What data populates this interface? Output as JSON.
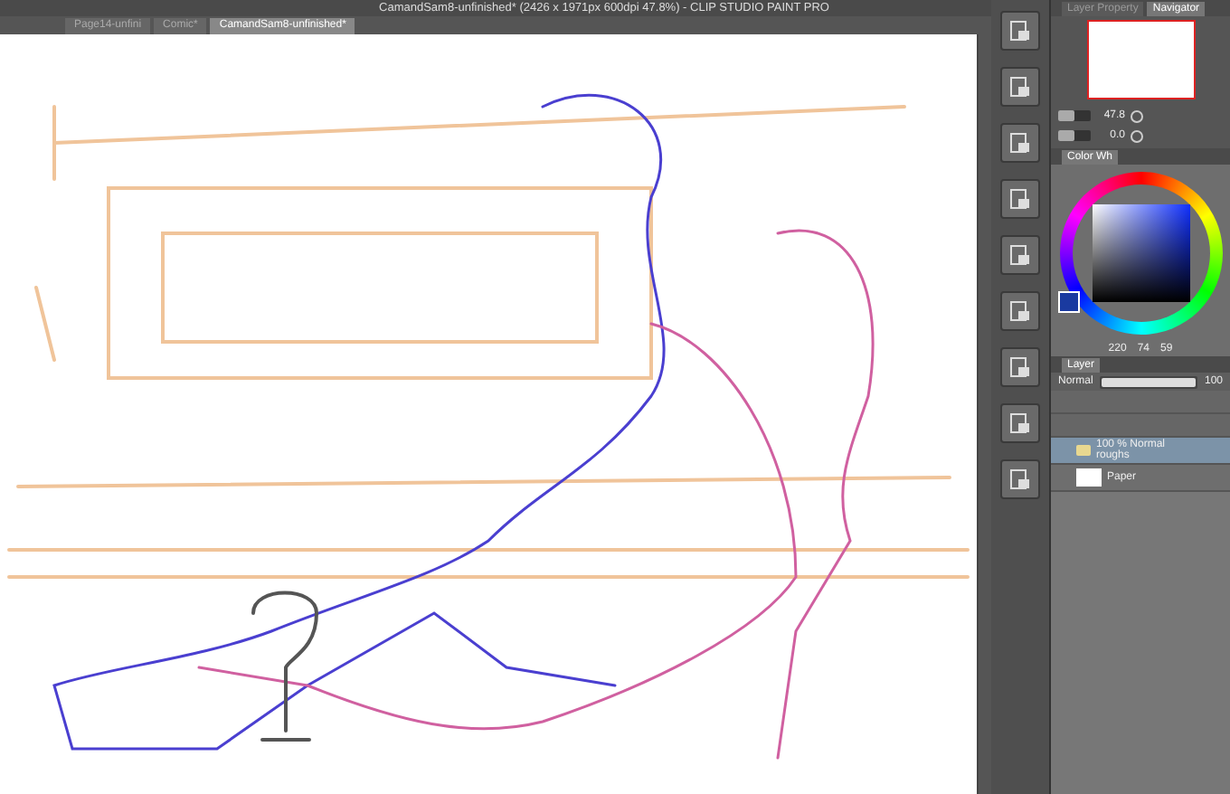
{
  "window": {
    "title": "CamandSam8-unfinished* (2426 x 1971px 600dpi 47.8%) - CLIP STUDIO PAINT PRO"
  },
  "document_tabs": [
    {
      "label": "Page14-unfini",
      "selected": false
    },
    {
      "label": "Comic*",
      "selected": false
    },
    {
      "label": "CamandSam8-unfinished*",
      "selected": true
    }
  ],
  "navigator": {
    "tabs": [
      {
        "label": "Layer Property",
        "selected": false
      },
      {
        "label": "Navigator",
        "selected": true
      }
    ],
    "zoom_slider": {
      "level": 0.5
    },
    "zoom": "47.8",
    "rotation_slider": {
      "level": 0.5
    },
    "rotation": "0.0"
  },
  "color_wheel": {
    "tab": "Color Wh",
    "values": [
      "220",
      "74",
      "59"
    ]
  },
  "layers": {
    "tab": "Layer",
    "blend_mode": "Normal",
    "opacity_slider": {
      "level": 1
    },
    "opacity": "100",
    "items": [
      {
        "kind": "folder",
        "info": "100 % Normal",
        "name": "roughs",
        "selected": true
      },
      {
        "kind": "paper",
        "name": "Paper",
        "selected": false
      }
    ]
  }
}
